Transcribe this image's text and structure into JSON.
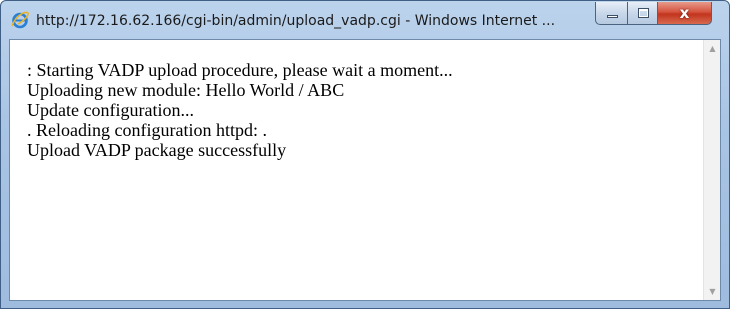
{
  "window": {
    "title": "http://172.16.62.166/cgi-bin/admin/upload_vadp.cgi - Windows Internet ...",
    "close_label": "x"
  },
  "icons": {
    "browser": "internet-explorer-icon",
    "minimize": "minimize-icon",
    "maximize": "maximize-icon",
    "close": "close-icon",
    "scroll_up": "scroll-up-arrow-icon",
    "scroll_down": "scroll-down-arrow-icon"
  },
  "content": {
    "lines": [
      ": Starting VADP upload procedure, please wait a moment...",
      "Uploading new module: Hello World / ABC",
      "Update configuration...",
      ". Reloading configuration httpd: .",
      "Upload VADP package successfully"
    ]
  },
  "colors": {
    "titlebar": "#a9c4e4",
    "close_button": "#c2341e",
    "content_bg": "#ffffff"
  }
}
